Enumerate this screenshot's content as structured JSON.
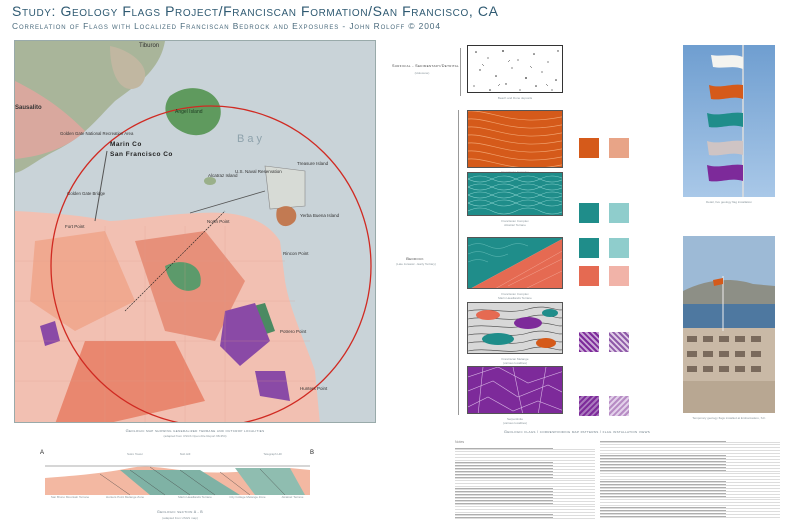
{
  "header": {
    "title": "Study: Geology Flags Project/Franciscan Formation/San Francisco, CA",
    "subtitle": "Correlation of Flags with Localized Franciscan Bedrock and Exposures - John Roloff © 2004"
  },
  "map": {
    "place_labels": [
      "Tiburon",
      "Sausalito",
      "Angel Island",
      "Marin Co",
      "San Francisco Co",
      "Golden Gate Bridge",
      "Treasure Island",
      "Yerba Buena Island",
      "Fort Point",
      "North Point",
      "Rincon Point",
      "Hunters Point",
      "Potrero Point",
      "Alcatraz Island",
      "U.S. Naval Reservation",
      "Golden Gate National Recreation Area",
      "Bay"
    ],
    "caption": "Geologic map showing generalized terrane and outcrop localities",
    "caption_credit": "(adapted from USGS Open-File Report 98-354)",
    "circle_color": "#d02a22"
  },
  "section": {
    "end_label_a": "A",
    "end_label_b": "B",
    "top_labels": [
      "Sutro Tower",
      "Nob Hill",
      "Telegraph Hill"
    ],
    "bottom_labels": [
      "San Bruno Mountain Terrane",
      "Hunters Point Melange Zone",
      "City College Melange Zone",
      "Marin Headlands Terrane",
      "Alcatraz Terrane"
    ],
    "caption": "Geologic section A - B",
    "caption_credit": "(adapted from USGS map)"
  },
  "legend": {
    "surficial_label": "Surficial - Sedimentary/Detrital",
    "surficial_sub": "(Holocene)",
    "surficial_caption": "Beach and Dune deposits",
    "bedrock_label": "Bedrock",
    "bedrock_sub": "(Late Jurassic - Early Tertiary)",
    "pattern_captions": [
      {
        "name": "Franciscan Complex",
        "sub": "San Bruno Mtn. Terrane"
      },
      {
        "name": "Franciscan Complex",
        "sub": "Alcatraz Terrane"
      },
      {
        "name": "Franciscan Complex",
        "sub": "Marin Headlands Terrane"
      },
      {
        "name": "Franciscan Melange",
        "sub": "(various localities)"
      },
      {
        "name": "Serpentinite",
        "sub": "(various localities)"
      }
    ],
    "caption": "Geologic flags / corresponding map patterns / flag installation views",
    "colors": {
      "orange": "#d55a1a",
      "orange_light": "#e8a487",
      "teal": "#1f8d8a",
      "teal_light": "#8fcdcc",
      "salmon": "#e56a52",
      "salmon_light": "#f1b3a8",
      "purple": "#7d2a9a",
      "purple_light": "#b78cc4"
    }
  },
  "photos": {
    "top_caption": "Detail, five geology flag installation",
    "bottom_caption": "Temporary geology flags installed at Embarcadero, S.F."
  },
  "notes": {
    "heading": "Notes"
  }
}
